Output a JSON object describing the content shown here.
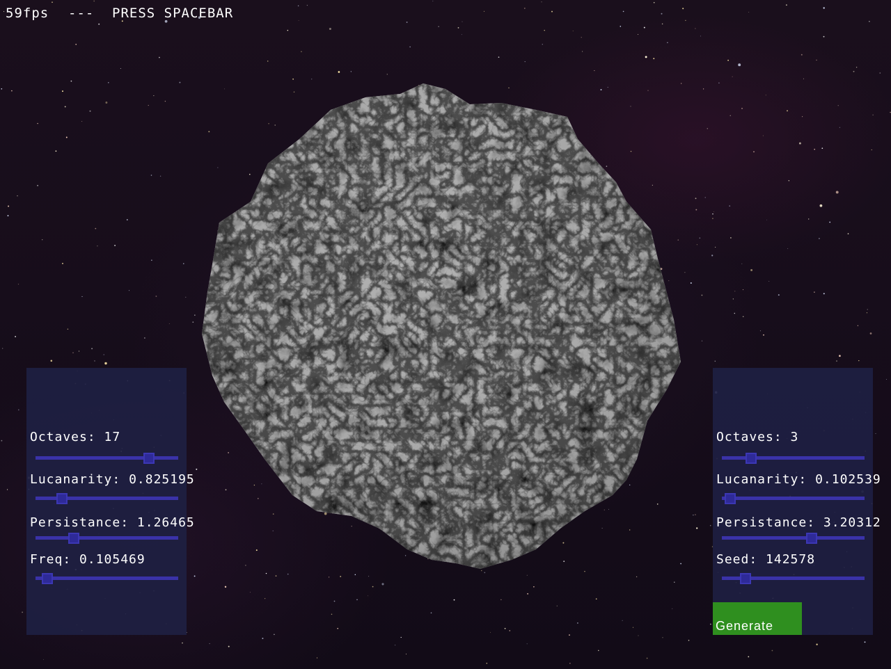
{
  "hud": {
    "fps": "59fps",
    "separator": "---",
    "prompt": "PRESS SPACEBAR"
  },
  "left_panel": {
    "params": [
      {
        "name": "Octaves:",
        "value": "17",
        "slider_fraction": 0.82
      },
      {
        "name": "Lucanarity:",
        "value": "0.825195",
        "slider_fraction": 0.16
      },
      {
        "name": "Persistance:",
        "value": "1.26465",
        "slider_fraction": 0.25
      },
      {
        "name": "Freq:",
        "value": "0.105469",
        "slider_fraction": 0.05
      }
    ]
  },
  "right_panel": {
    "params": [
      {
        "name": "Octaves:",
        "value": "3",
        "slider_fraction": 0.18
      },
      {
        "name": "Lucanarity:",
        "value": "0.102539",
        "slider_fraction": 0.02
      },
      {
        "name": "Persistance:",
        "value": "3.20312",
        "slider_fraction": 0.64
      },
      {
        "name": "Seed:",
        "value": "142578",
        "slider_fraction": 0.14
      }
    ],
    "generate_label": "Generate"
  },
  "colors": {
    "panel_bg": "#1e2042",
    "slider_track": "#3a32a8",
    "slider_thumb": "#2e2a98",
    "generate_button": "#2f8f1f",
    "text": "#ffffff"
  },
  "scene": {
    "object": "procedural asteroid",
    "background": "starfield"
  }
}
